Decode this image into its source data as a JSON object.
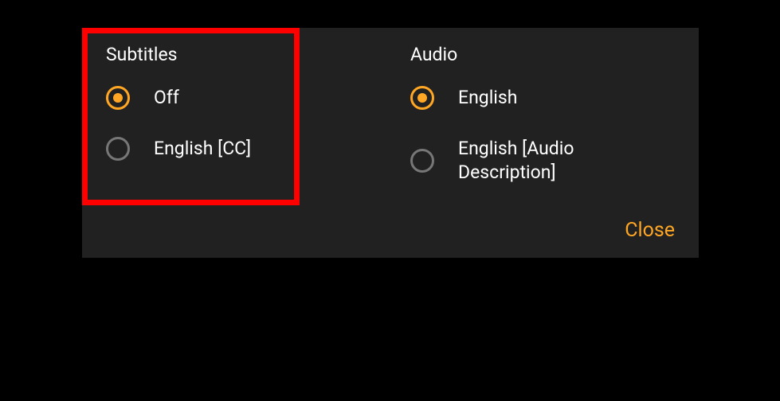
{
  "subtitles": {
    "title": "Subtitles",
    "options": [
      {
        "label": "Off",
        "selected": true
      },
      {
        "label": "English [CC]",
        "selected": false
      }
    ]
  },
  "audio": {
    "title": "Audio",
    "options": [
      {
        "label": "English",
        "selected": true
      },
      {
        "label": "English [Audio Description]",
        "selected": false
      }
    ]
  },
  "close_label": "Close",
  "colors": {
    "accent": "#ffa724",
    "panel_bg": "#212121",
    "text": "#ffffff",
    "radio_unselected": "#777777",
    "highlight": "#ff0000"
  }
}
